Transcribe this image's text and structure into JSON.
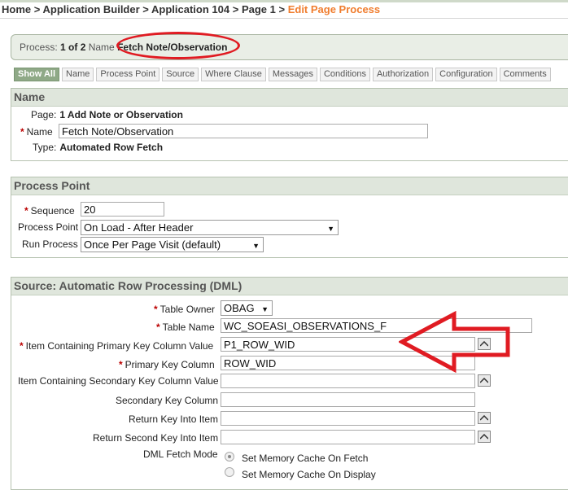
{
  "breadcrumb": {
    "items": [
      "Home",
      "Application Builder",
      "Application 104",
      "Page 1"
    ],
    "current": "Edit Page Process"
  },
  "process_bar": {
    "label": "Process:",
    "count": "1 of 2",
    "name_label": "Name",
    "name_value": "Fetch Note/Observation"
  },
  "tabs": [
    "Show All",
    "Name",
    "Process Point",
    "Source",
    "Where Clause",
    "Messages",
    "Conditions",
    "Authorization",
    "Configuration",
    "Comments"
  ],
  "name_region": {
    "title": "Name",
    "page_label": "Page:",
    "page_value": "1 Add Note or Observation",
    "name_label": "Name",
    "name_value": "Fetch Note/Observation",
    "type_label": "Type:",
    "type_value": "Automated Row Fetch"
  },
  "process_point_region": {
    "title": "Process Point",
    "sequence_label": "Sequence",
    "sequence_value": "20",
    "point_label": "Process Point",
    "point_value": "On Load - After Header",
    "run_label": "Run Process",
    "run_value": "Once Per Page Visit (default)"
  },
  "source_region": {
    "title": "Source: Automatic Row Processing (DML)",
    "owner_label": "Table Owner",
    "owner_value": "OBAG",
    "table_label": "Table Name",
    "table_value": "WC_SOEASI_OBSERVATIONS_F",
    "pk_item_label": "Item Containing Primary Key Column Value",
    "pk_item_value": "P1_ROW_WID",
    "pk_col_label": "Primary Key Column",
    "pk_col_value": "ROW_WID",
    "sk_item_label": "Item Containing Secondary Key Column Value",
    "sk_item_value": "",
    "sk_col_label": "Secondary Key Column",
    "sk_col_value": "",
    "return_key_label": "Return Key Into Item",
    "return_key_value": "",
    "return_second_label": "Return Second Key Into Item",
    "return_second_value": "",
    "fetch_mode_label": "DML Fetch Mode",
    "fetch_options": [
      "Set Memory Cache On Fetch",
      "Set Memory Cache On Display"
    ]
  },
  "annotation_color": "#e01b22"
}
